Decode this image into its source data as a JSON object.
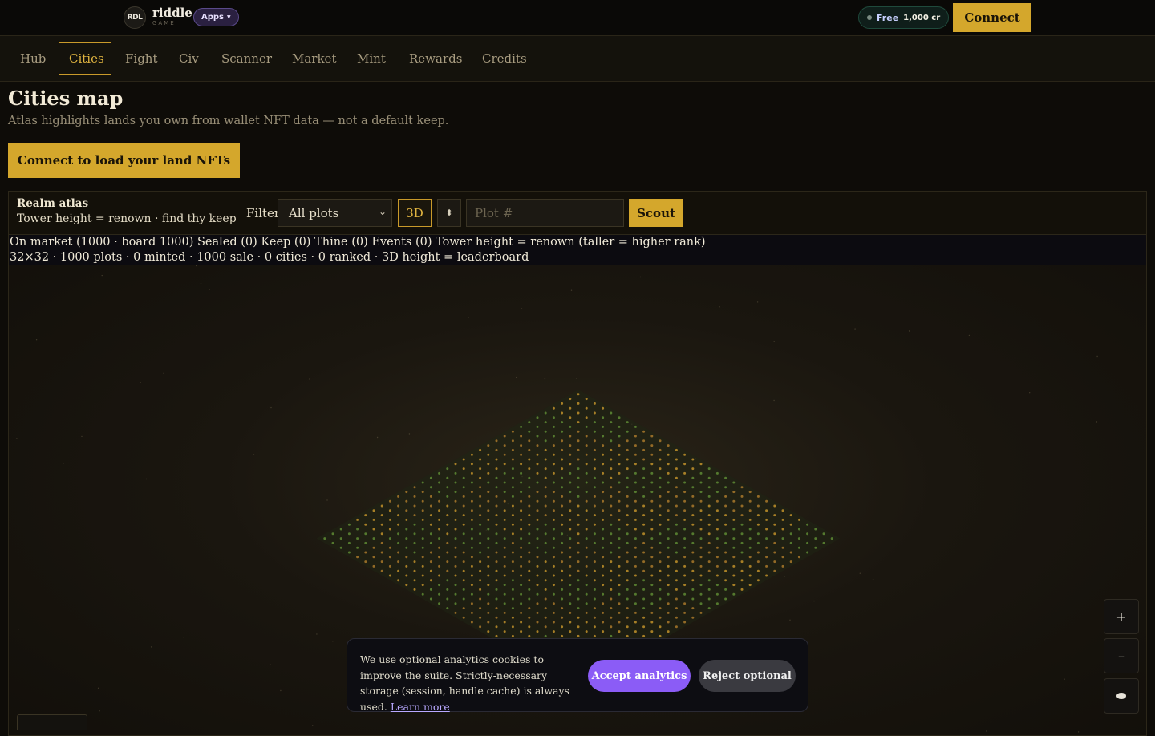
{
  "topbar": {
    "logo_text": "RDL",
    "brand": "riddle",
    "brand_sub": "GAME",
    "apps_label": "Apps",
    "credits_label": "Free",
    "credits_value": "1,000 cr",
    "connect_label": "Connect"
  },
  "nav": {
    "items": [
      {
        "label": "Hub"
      },
      {
        "label": "Cities"
      },
      {
        "label": "Fight"
      },
      {
        "label": "Civ"
      },
      {
        "label": "Scanner"
      },
      {
        "label": "Market"
      },
      {
        "label": "Mint"
      },
      {
        "label": "Rewards"
      },
      {
        "label": "Credits"
      }
    ],
    "active": "Cities"
  },
  "header": {
    "title": "Cities map",
    "subtitle": "Atlas highlights lands you own from wallet NFT data — not a default keep.",
    "load_button": "Connect to load your land NFTs"
  },
  "atlas": {
    "title": "Realm atlas",
    "tagline": "Tower height = renown · find thy keep",
    "filter_label": "Filter",
    "filter_value": "All plots",
    "mode_3d": "3D",
    "sort_icon": "sort-icon",
    "plot_placeholder": "Plot #",
    "scout_label": "Scout",
    "stats_line1": "On market (1000 · board 1000) Sealed (0) Keep (0) Thine (0) Events (0) Tower height = renown (taller = higher rank)",
    "stats_line2": "32×32 · 1000 plots · 0 minted · 1000 sale · 0 cities · 0 ranked · 3D height = leaderboard",
    "grid_size": 32,
    "zoom_in": "+",
    "zoom_out": "–",
    "view_icon": "eye-icon"
  },
  "cookie": {
    "text": "We use optional analytics cookies to improve the suite. Strictly-necessary storage (session, handle cache) is always used.",
    "learn_more": "Learn more",
    "accept": "Accept analytics",
    "reject": "Reject optional"
  },
  "colors": {
    "accent": "#d4a72c",
    "cookie_accept": "#8b5cf6"
  }
}
